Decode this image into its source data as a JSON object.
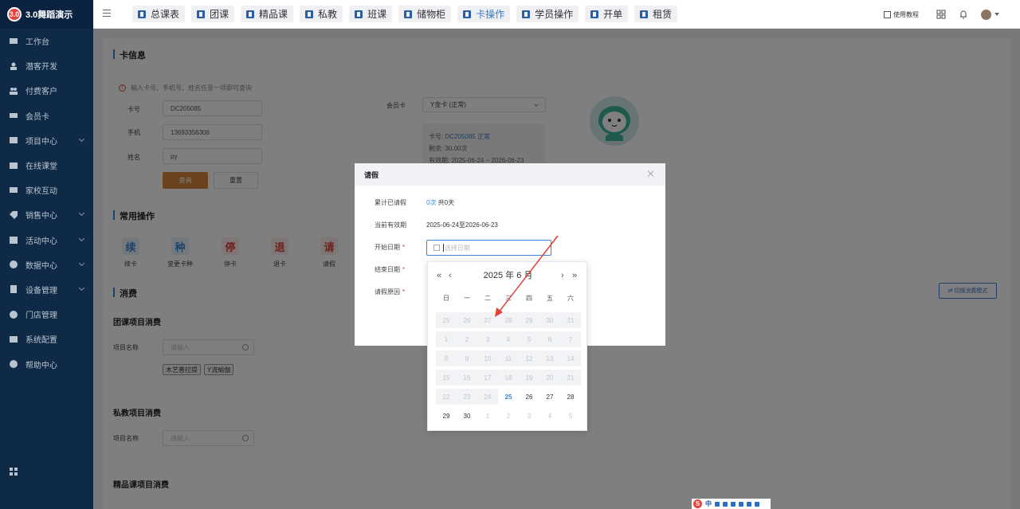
{
  "app": {
    "logo_mark": "3.0",
    "title": "3.0舞蹈演示"
  },
  "sidebar": {
    "items": [
      {
        "label": "工作台",
        "icon": "monitor-icon",
        "has_children": false
      },
      {
        "label": "潜客开发",
        "icon": "users-icon",
        "has_children": false
      },
      {
        "label": "付费客户",
        "icon": "user-group-icon",
        "has_children": false
      },
      {
        "label": "会员卡",
        "icon": "card-icon",
        "has_children": false
      },
      {
        "label": "项目中心",
        "icon": "folder-icon",
        "has_children": true
      },
      {
        "label": "在线课堂",
        "icon": "video-icon",
        "has_children": false
      },
      {
        "label": "家校互动",
        "icon": "chat-icon",
        "has_children": false
      },
      {
        "label": "销售中心",
        "icon": "tag-icon",
        "has_children": true
      },
      {
        "label": "活动中心",
        "icon": "calendar-icon",
        "has_children": true
      },
      {
        "label": "数据中心",
        "icon": "chart-icon",
        "has_children": true
      },
      {
        "label": "设备管理",
        "icon": "device-icon",
        "has_children": true
      },
      {
        "label": "门店管理",
        "icon": "store-icon",
        "has_children": false
      },
      {
        "label": "系统配置",
        "icon": "settings-icon",
        "has_children": false
      },
      {
        "label": "帮助中心",
        "icon": "help-icon",
        "has_children": false
      }
    ]
  },
  "topnav": {
    "tabs": [
      {
        "label": "总课表",
        "active": false
      },
      {
        "label": "团课",
        "active": false
      },
      {
        "label": "精品课",
        "active": false
      },
      {
        "label": "私教",
        "active": false
      },
      {
        "label": "班课",
        "active": false
      },
      {
        "label": "储物柜",
        "active": false
      },
      {
        "label": "卡操作",
        "active": true
      },
      {
        "label": "学员操作",
        "active": false
      },
      {
        "label": "开单",
        "active": false
      },
      {
        "label": "租赁",
        "active": false
      }
    ],
    "help_label": "使用教程"
  },
  "card_info": {
    "title": "卡信息",
    "hint": "输入卡号、手机号、姓名任意一项即可查询",
    "card_no_label": "卡号",
    "card_no_value": "DC205085",
    "phone_label": "手机",
    "phone_value": "13693356306",
    "name_label": "姓名",
    "name_value": "py",
    "query_button": "查询",
    "reset_button": "重置",
    "member_card_label": "会员卡",
    "member_card_value": "Y金卡 (正常)",
    "detail_card_label": "卡号:",
    "detail_card_value": "DC205085 正常",
    "detail_remaining": "剩余: 30.00次",
    "detail_validity": "有效期: 2025-06-24 ~ 2026-06-23"
  },
  "common_ops": {
    "title": "常用操作",
    "items": [
      {
        "glyph": "续",
        "label": "续卡",
        "color": "#3a86d6",
        "bg": "#e6f0fb"
      },
      {
        "glyph": "种",
        "label": "变更卡种",
        "color": "#3a86d6",
        "bg": "#e6f0fb"
      },
      {
        "glyph": "停",
        "label": "停卡",
        "color": "#e0413a",
        "bg": "#fdeceb"
      },
      {
        "glyph": "退",
        "label": "退卡",
        "color": "#e0413a",
        "bg": "#fdeceb"
      },
      {
        "glyph": "请",
        "label": "请假",
        "color": "#e0413a",
        "bg": "#fdeceb"
      }
    ]
  },
  "consume": {
    "title": "消费",
    "switch_button": "⇄ 切换消费模式",
    "group_title": "团课项目消费",
    "project_label": "项目名称",
    "search_placeholder": "请输入",
    "group_tags": [
      "木艺普拉提",
      "Y流瑜伽"
    ],
    "private_title": "私教项目消费",
    "private_project_label": "项目名称",
    "private_placeholder": "请输入",
    "boutique_title": "精品课项目消费"
  },
  "leave_dialog": {
    "title": "请假",
    "accum_label": "累计已请假",
    "accum_count": "0次",
    "accum_days": " 共0天",
    "validity_label": "当前有效期",
    "validity_value": "2025-06-24至2026-06-23",
    "start_label": "开始日期",
    "start_placeholder": "选择日期",
    "end_label": "结束日期",
    "reason_label": "请假原因",
    "required_mark": "*"
  },
  "calendar": {
    "year_month": "2025 年  6 月",
    "weekdays": [
      "日",
      "一",
      "二",
      "三",
      "四",
      "五",
      "六"
    ],
    "rows": [
      [
        {
          "d": "25",
          "s": "dis"
        },
        {
          "d": "26",
          "s": "dis"
        },
        {
          "d": "27",
          "s": "dis"
        },
        {
          "d": "28",
          "s": "dis"
        },
        {
          "d": "29",
          "s": "dis"
        },
        {
          "d": "30",
          "s": "dis"
        },
        {
          "d": "31",
          "s": "dis"
        }
      ],
      [
        {
          "d": "1",
          "s": "dis"
        },
        {
          "d": "2",
          "s": "dis"
        },
        {
          "d": "3",
          "s": "dis"
        },
        {
          "d": "4",
          "s": "dis"
        },
        {
          "d": "5",
          "s": "dis"
        },
        {
          "d": "6",
          "s": "dis"
        },
        {
          "d": "7",
          "s": "dis"
        }
      ],
      [
        {
          "d": "8",
          "s": "dis"
        },
        {
          "d": "9",
          "s": "dis"
        },
        {
          "d": "10",
          "s": "dis"
        },
        {
          "d": "11",
          "s": "dis"
        },
        {
          "d": "12",
          "s": "dis"
        },
        {
          "d": "13",
          "s": "dis"
        },
        {
          "d": "14",
          "s": "dis"
        }
      ],
      [
        {
          "d": "15",
          "s": "dis"
        },
        {
          "d": "16",
          "s": "dis"
        },
        {
          "d": "17",
          "s": "dis"
        },
        {
          "d": "18",
          "s": "dis"
        },
        {
          "d": "19",
          "s": "dis"
        },
        {
          "d": "20",
          "s": "dis"
        },
        {
          "d": "21",
          "s": "dis"
        }
      ],
      [
        {
          "d": "22",
          "s": "dis"
        },
        {
          "d": "23",
          "s": "dis"
        },
        {
          "d": "24",
          "s": "dis"
        },
        {
          "d": "25",
          "s": "today"
        },
        {
          "d": "26",
          "s": ""
        },
        {
          "d": "27",
          "s": ""
        },
        {
          "d": "28",
          "s": ""
        }
      ],
      [
        {
          "d": "29",
          "s": ""
        },
        {
          "d": "30",
          "s": ""
        },
        {
          "d": "1",
          "s": "other"
        },
        {
          "d": "2",
          "s": "other"
        },
        {
          "d": "3",
          "s": "other"
        },
        {
          "d": "4",
          "s": "other"
        },
        {
          "d": "5",
          "s": "other"
        }
      ]
    ]
  },
  "ime": {
    "logo": "S",
    "mode": "中"
  },
  "colors": {
    "sidebar_bg": "#0e2a47",
    "accent": "#3a86d6",
    "query_button": "#d9823b",
    "arrow": "#e0413a"
  }
}
